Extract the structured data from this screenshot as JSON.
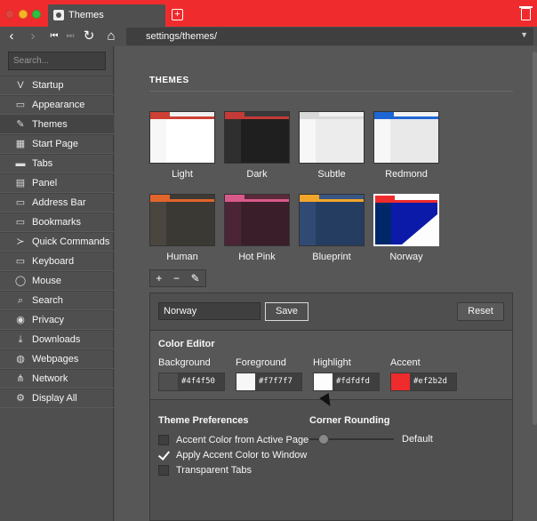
{
  "tab": {
    "title": "Themes"
  },
  "address": {
    "url": "settings/themes/"
  },
  "sidebar": {
    "search_placeholder": "Search...",
    "items": [
      {
        "label": "Startup",
        "icon": "vivaldi-icon",
        "glyph": "V"
      },
      {
        "label": "Appearance",
        "icon": "folder-icon",
        "glyph": "▭"
      },
      {
        "label": "Themes",
        "icon": "brush-icon",
        "glyph": "✎"
      },
      {
        "label": "Start Page",
        "icon": "grid-icon",
        "glyph": "▦"
      },
      {
        "label": "Tabs",
        "icon": "tabs-icon",
        "glyph": "▬"
      },
      {
        "label": "Panel",
        "icon": "panel-icon",
        "glyph": "▤"
      },
      {
        "label": "Address Bar",
        "icon": "address-bar-icon",
        "glyph": "▭"
      },
      {
        "label": "Bookmarks",
        "icon": "bookmark-icon",
        "glyph": "▭"
      },
      {
        "label": "Quick Commands",
        "icon": "quick-commands-icon",
        "glyph": "≻"
      },
      {
        "label": "Keyboard",
        "icon": "keyboard-icon",
        "glyph": "▭"
      },
      {
        "label": "Mouse",
        "icon": "mouse-icon",
        "glyph": "◯"
      },
      {
        "label": "Search",
        "icon": "search-icon",
        "glyph": "⌕"
      },
      {
        "label": "Privacy",
        "icon": "eye-icon",
        "glyph": "◉"
      },
      {
        "label": "Downloads",
        "icon": "download-icon",
        "glyph": "⤓"
      },
      {
        "label": "Webpages",
        "icon": "globe-icon",
        "glyph": "◍"
      },
      {
        "label": "Network",
        "icon": "network-icon",
        "glyph": "⋔"
      },
      {
        "label": "Display All",
        "icon": "gear-icon",
        "glyph": "⚙"
      }
    ]
  },
  "themes_section": {
    "title": "THEMES",
    "themes": [
      {
        "name": "Light",
        "bar": "#cc4035",
        "bar2": "#f0f0f0",
        "side": "#f7f7f7",
        "content": "#ffffff"
      },
      {
        "name": "Dark",
        "bar": "#c43a36",
        "bar2": "#3a3a3a",
        "side": "#2f2f2f",
        "content": "#1f1f1f"
      },
      {
        "name": "Subtle",
        "bar": "#d8d8d8",
        "bar2": "#f0f0f0",
        "side": "#f7f7f7",
        "content": "#ececec"
      },
      {
        "name": "Redmond",
        "bar": "#1e66d4",
        "bar2": "#f2f2f2",
        "side": "#f7f7f7",
        "content": "#e9e9e9"
      },
      {
        "name": "Human",
        "bar": "#e2652b",
        "bar2": "#3d3a35",
        "side": "#4a463f",
        "content": "#3b3933"
      },
      {
        "name": "Hot Pink",
        "bar": "#d85a8a",
        "bar2": "#5a2a3a",
        "side": "#4b2535",
        "content": "#3a1e2a"
      },
      {
        "name": "Blueprint",
        "bar": "#f2a62a",
        "bar2": "#3a5685",
        "side": "#314a73",
        "content": "#263d62"
      },
      {
        "name": "Norway",
        "bar": "#ef2b2d",
        "bar2": "#fdfdfd",
        "side": "#002868",
        "content": "#0b1aa8"
      }
    ]
  },
  "tools": {
    "add": "+",
    "remove": "−",
    "edit": "✎"
  },
  "editor": {
    "name_value": "Norway",
    "save_label": "Save",
    "reset_label": "Reset",
    "color_editor_title": "Color Editor",
    "swatches": [
      {
        "label": "Background",
        "hex": "#4f4f50"
      },
      {
        "label": "Foreground",
        "hex": "#f7f7f7"
      },
      {
        "label": "Highlight",
        "hex": "#fdfdfd"
      },
      {
        "label": "Accent",
        "hex": "#ef2b2d"
      }
    ],
    "prefs_title": "Theme Preferences",
    "prefs": [
      {
        "label": "Accent Color from Active Page",
        "checked": false
      },
      {
        "label": "Apply Accent Color to Window",
        "checked": true
      },
      {
        "label": "Transparent Tabs",
        "checked": false
      }
    ],
    "corner_title": "Corner Rounding",
    "corner_value": "Default"
  }
}
